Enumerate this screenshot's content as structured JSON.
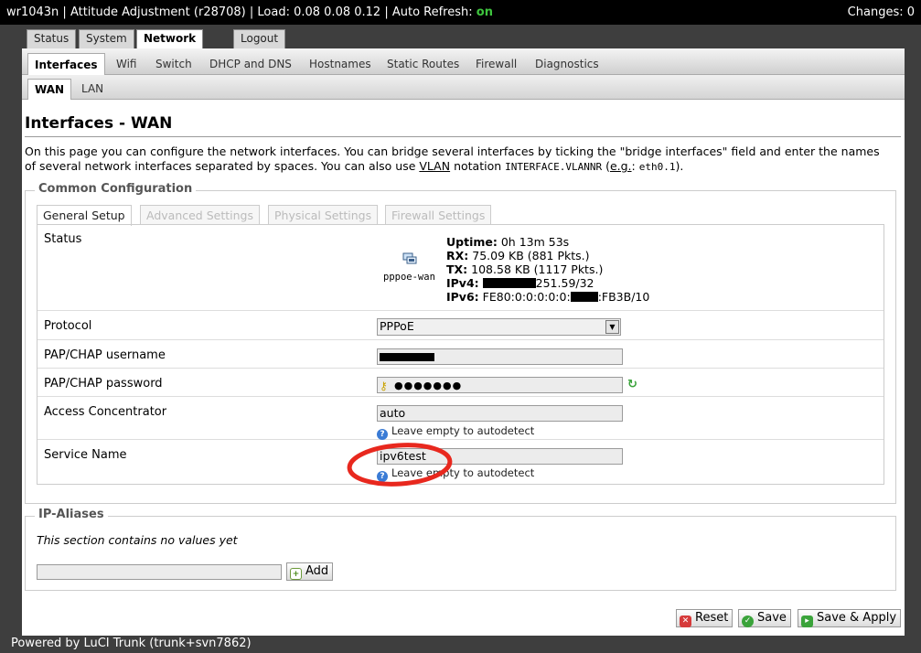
{
  "header": {
    "title": "wr1043n | Attitude Adjustment (r28708) | Load: 0.08 0.08 0.12 | Auto Refresh:",
    "auto_refresh": "on",
    "changes": "Changes: 0"
  },
  "tabs_main": [
    "Status",
    "System",
    "Network",
    "Logout"
  ],
  "tabs_network": [
    "Interfaces",
    "Wifi",
    "Switch",
    "DHCP and DNS",
    "Hostnames",
    "Static Routes",
    "Firewall",
    "Diagnostics"
  ],
  "tabs_iface": [
    "WAN",
    "LAN"
  ],
  "page": {
    "title": "Interfaces - WAN",
    "desc_1": "On this page you can configure the network interfaces. You can bridge several interfaces by ticking the \"bridge interfaces\" field and enter the names",
    "desc_2a": "of several network interfaces separated by spaces. You can also use ",
    "desc_vlan": "VLAN",
    "desc_2b": " notation ",
    "desc_code1": "INTERFACE.VLANNR",
    "desc_2c": " (",
    "desc_eg": "e.g.",
    "desc_2d": ": ",
    "desc_code2": "eth0.1",
    "desc_2e": ")."
  },
  "common": {
    "legend": "Common Configuration",
    "subtabs": [
      "General Setup",
      "Advanced Settings",
      "Physical Settings",
      "Firewall Settings"
    ]
  },
  "status": {
    "label": "Status",
    "iface_name": "pppoe-wan",
    "uptime_label": "Uptime:",
    "uptime": "0h 13m 53s",
    "rx_label": "RX:",
    "rx": "75.09 KB (881 Pkts.)",
    "tx_label": "TX:",
    "tx": "108.58 KB (1117 Pkts.)",
    "ipv4_label": "IPv4:",
    "ipv4_suffix": "251.59/32",
    "ipv6_label": "IPv6:",
    "ipv6_prefix": "FE80:0:0:0:0:0:",
    "ipv6_suffix": ":FB3B/10"
  },
  "fields": {
    "protocol_label": "Protocol",
    "protocol_value": "PPPoE",
    "username_label": "PAP/CHAP username",
    "password_label": "PAP/CHAP password",
    "password_value": "●●●●●●●",
    "ac_label": "Access Concentrator",
    "ac_value": "auto",
    "ac_hint": "Leave empty to autodetect",
    "service_label": "Service Name",
    "service_value": "ipv6test",
    "service_hint": "Leave empty to autodetect"
  },
  "aliases": {
    "legend": "IP-Aliases",
    "empty_text": "This section contains no values yet",
    "add_label": "Add"
  },
  "actions": {
    "reset": "Reset",
    "save": "Save",
    "save_apply": "Save & Apply"
  },
  "footer": "Powered by LuCI Trunk (trunk+svn7862)",
  "colors": {
    "accent_on": "#3ec43e",
    "annotation": "#e8281e"
  }
}
